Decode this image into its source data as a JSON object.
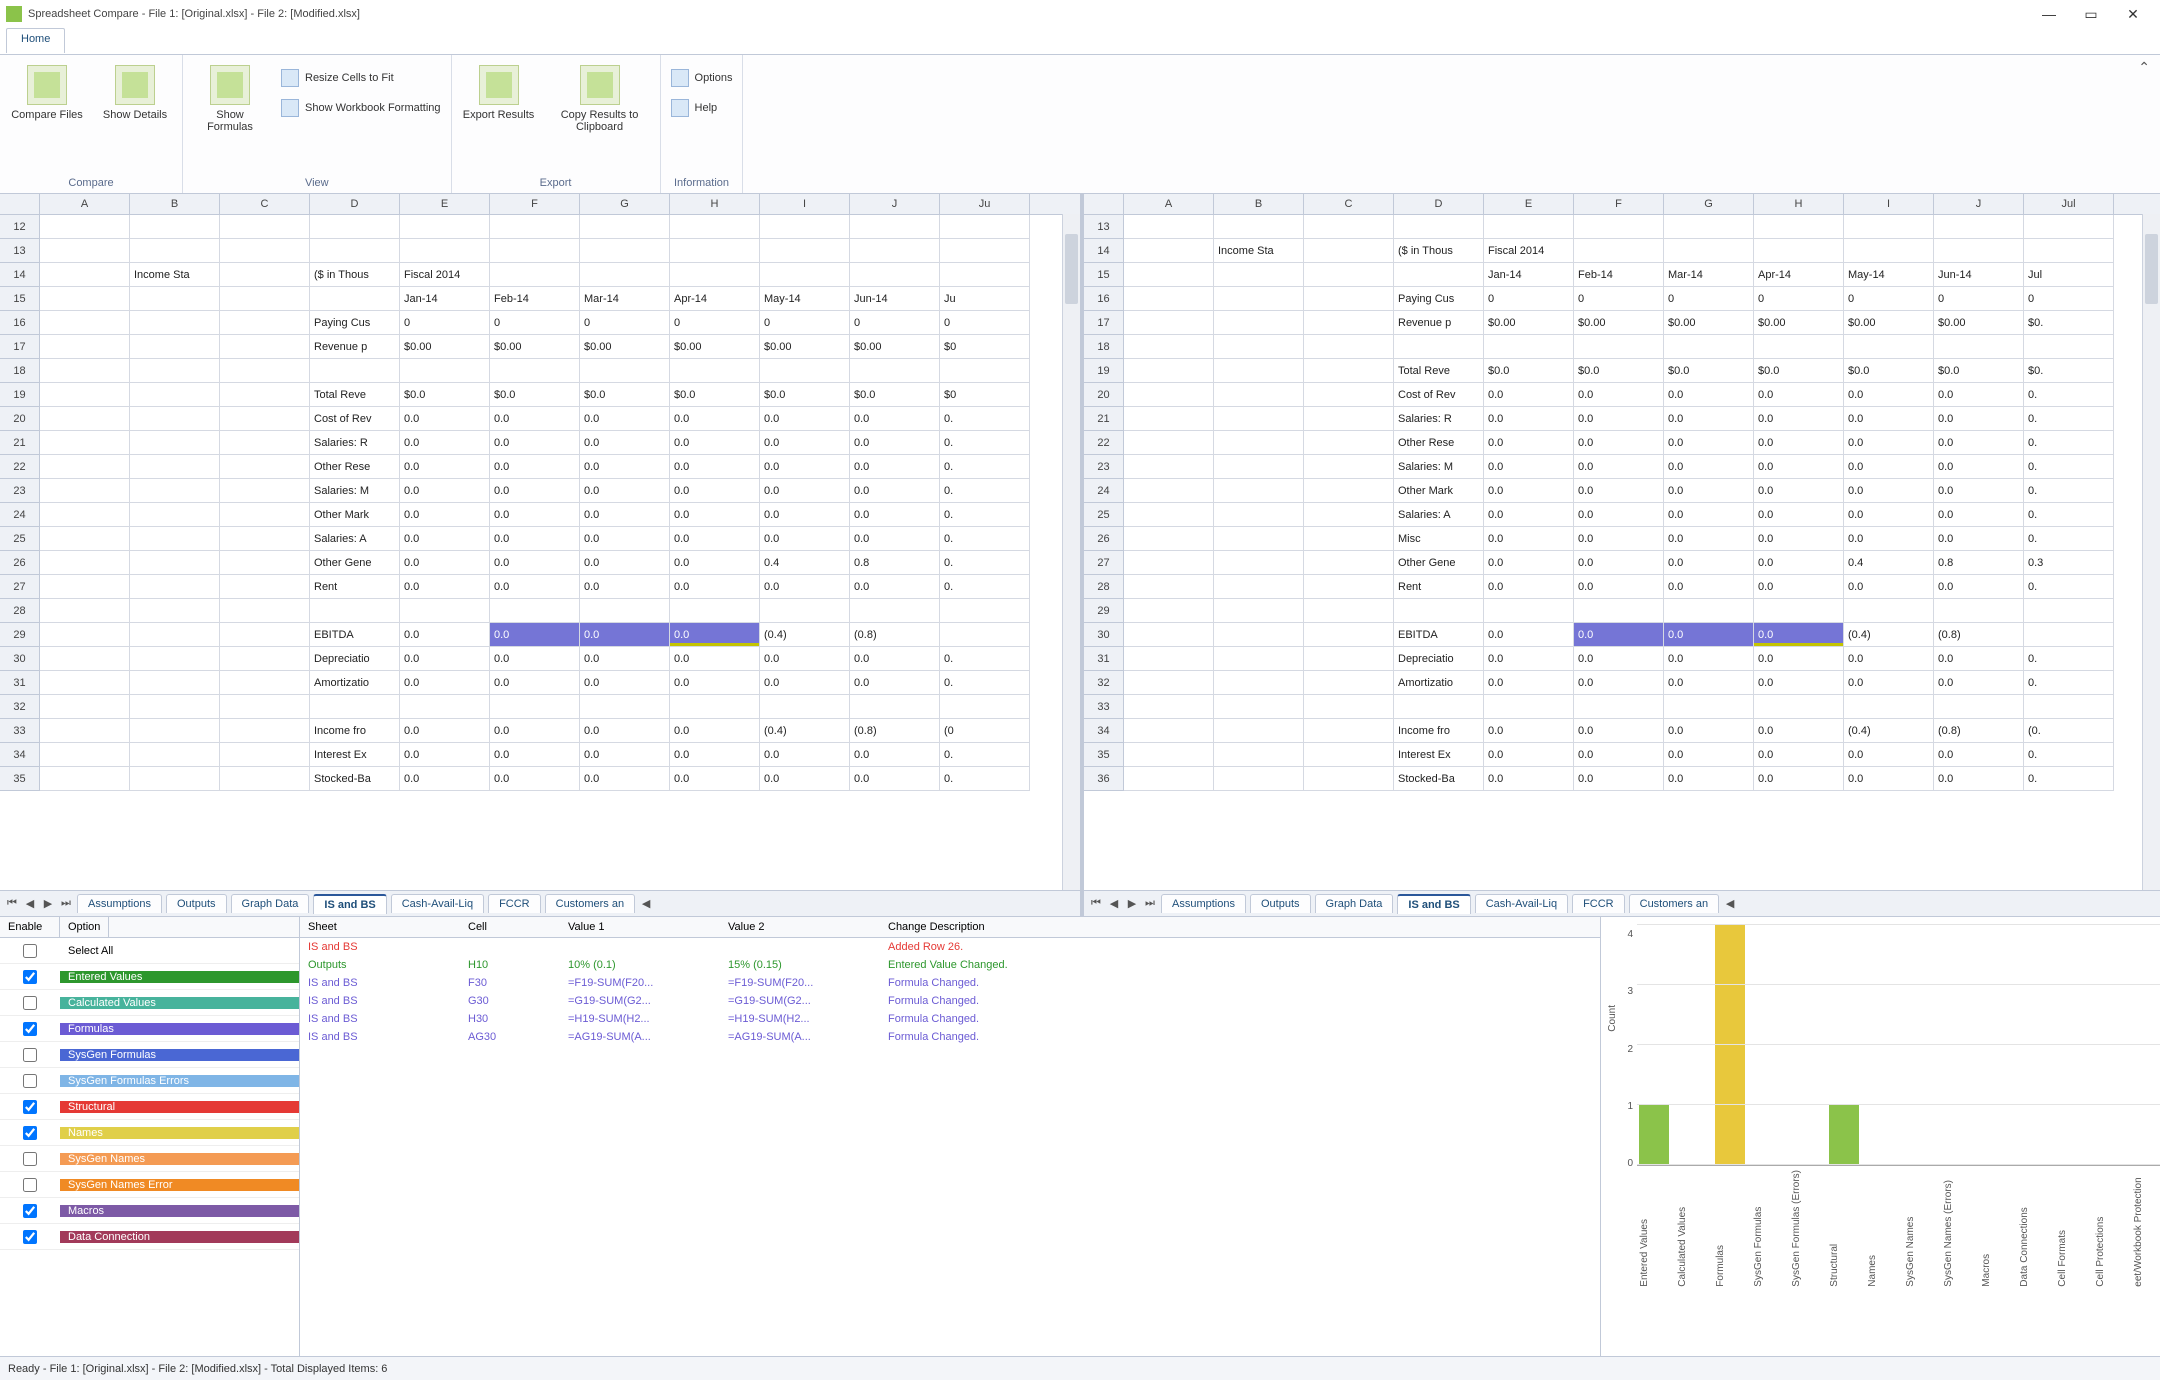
{
  "title": "Spreadsheet Compare - File 1: [Original.xlsx] - File 2: [Modified.xlsx]",
  "menubar": {
    "home": "Home"
  },
  "ribbon": {
    "groups": {
      "compare": {
        "label": "Compare",
        "buttons": {
          "compare_files": "Compare Files",
          "show_details": "Show Details"
        }
      },
      "view": {
        "label": "View",
        "buttons": {
          "show_formulas": "Show Formulas",
          "resize": "Resize Cells to Fit",
          "show_formatting": "Show Workbook Formatting"
        }
      },
      "export": {
        "label": "Export",
        "buttons": {
          "export_results": "Export Results",
          "copy_clipboard": "Copy Results to Clipboard"
        }
      },
      "information": {
        "label": "Information",
        "buttons": {
          "options": "Options",
          "help": "Help"
        }
      }
    }
  },
  "columns": [
    "A",
    "B",
    "C",
    "D",
    "E",
    "F",
    "G",
    "H",
    "I",
    "J",
    "Ju"
  ],
  "columns_right": [
    "A",
    "B",
    "C",
    "D",
    "E",
    "F",
    "G",
    "H",
    "I",
    "J",
    "Jul"
  ],
  "left_grid": {
    "start": 12,
    "rows": [
      {
        "r": 12
      },
      {
        "r": 13
      },
      {
        "r": 14,
        "B": "Income Sta",
        "D": "($ in Thous",
        "E": "Fiscal 2014"
      },
      {
        "r": 15,
        "E": "Jan-14",
        "F": "Feb-14",
        "G": "Mar-14",
        "H": "Apr-14",
        "I": "May-14",
        "J": "Jun-14",
        "K": "Ju"
      },
      {
        "r": 16,
        "D": "Paying Cus",
        "E": "0",
        "F": "0",
        "G": "0",
        "H": "0",
        "I": "0",
        "J": "0",
        "K": "0"
      },
      {
        "r": 17,
        "D": "Revenue p",
        "E": "$0.00",
        "F": "$0.00",
        "G": "$0.00",
        "H": "$0.00",
        "I": "$0.00",
        "J": "$0.00",
        "K": "$0"
      },
      {
        "r": 18
      },
      {
        "r": 19,
        "D": "Total Reve",
        "E": "$0.0",
        "F": "$0.0",
        "G": "$0.0",
        "H": "$0.0",
        "I": "$0.0",
        "J": "$0.0",
        "K": "$0"
      },
      {
        "r": 20,
        "D": "Cost of Rev",
        "E": "0.0",
        "F": "0.0",
        "G": "0.0",
        "H": "0.0",
        "I": "0.0",
        "J": "0.0",
        "K": "0."
      },
      {
        "r": 21,
        "D": "Salaries: R",
        "E": "0.0",
        "F": "0.0",
        "G": "0.0",
        "H": "0.0",
        "I": "0.0",
        "J": "0.0",
        "K": "0."
      },
      {
        "r": 22,
        "D": "Other Rese",
        "E": "0.0",
        "F": "0.0",
        "G": "0.0",
        "H": "0.0",
        "I": "0.0",
        "J": "0.0",
        "K": "0."
      },
      {
        "r": 23,
        "D": "Salaries: M",
        "E": "0.0",
        "F": "0.0",
        "G": "0.0",
        "H": "0.0",
        "I": "0.0",
        "J": "0.0",
        "K": "0."
      },
      {
        "r": 24,
        "D": "Other Mark",
        "E": "0.0",
        "F": "0.0",
        "G": "0.0",
        "H": "0.0",
        "I": "0.0",
        "J": "0.0",
        "K": "0."
      },
      {
        "r": 25,
        "D": "Salaries: A",
        "E": "0.0",
        "F": "0.0",
        "G": "0.0",
        "H": "0.0",
        "I": "0.0",
        "J": "0.0",
        "K": "0."
      },
      {
        "r": 26,
        "D": "Other Gene",
        "E": "0.0",
        "F": "0.0",
        "G": "0.0",
        "H": "0.0",
        "I": "0.4",
        "J": "0.8",
        "K": "0."
      },
      {
        "r": 27,
        "D": "Rent",
        "E": "0.0",
        "F": "0.0",
        "G": "0.0",
        "H": "0.0",
        "I": "0.0",
        "J": "0.0",
        "K": "0."
      },
      {
        "r": 28
      },
      {
        "r": 29,
        "D": "EBITDA",
        "E": "0.0",
        "F": "0.0",
        "G": "0.0",
        "H": "0.0",
        "I": "(0.4)",
        "J": "(0.8)",
        "hl": [
          "F",
          "G",
          "H"
        ]
      },
      {
        "r": 30,
        "D": "Depreciatio",
        "E": "0.0",
        "F": "0.0",
        "G": "0.0",
        "H": "0.0",
        "I": "0.0",
        "J": "0.0",
        "K": "0."
      },
      {
        "r": 31,
        "D": "Amortizatio",
        "E": "0.0",
        "F": "0.0",
        "G": "0.0",
        "H": "0.0",
        "I": "0.0",
        "J": "0.0",
        "K": "0."
      },
      {
        "r": 32
      },
      {
        "r": 33,
        "D": "Income fro",
        "E": "0.0",
        "F": "0.0",
        "G": "0.0",
        "H": "0.0",
        "I": "(0.4)",
        "J": "(0.8)",
        "K": "(0"
      },
      {
        "r": 34,
        "D": "Interest Ex",
        "E": "0.0",
        "F": "0.0",
        "G": "0.0",
        "H": "0.0",
        "I": "0.0",
        "J": "0.0",
        "K": "0."
      },
      {
        "r": 35,
        "D": "Stocked-Ba",
        "E": "0.0",
        "F": "0.0",
        "G": "0.0",
        "H": "0.0",
        "I": "0.0",
        "J": "0.0",
        "K": "0."
      }
    ]
  },
  "right_grid": {
    "start": 13,
    "rows": [
      {
        "r": 13
      },
      {
        "r": 14,
        "B": "Income Sta",
        "D": "($ in Thous",
        "E": "Fiscal 2014"
      },
      {
        "r": 15,
        "E": "Jan-14",
        "F": "Feb-14",
        "G": "Mar-14",
        "H": "Apr-14",
        "I": "May-14",
        "J": "Jun-14",
        "K": "Jul"
      },
      {
        "r": 16,
        "D": "Paying Cus",
        "E": "0",
        "F": "0",
        "G": "0",
        "H": "0",
        "I": "0",
        "J": "0",
        "K": "0"
      },
      {
        "r": 17,
        "D": "Revenue p",
        "E": "$0.00",
        "F": "$0.00",
        "G": "$0.00",
        "H": "$0.00",
        "I": "$0.00",
        "J": "$0.00",
        "K": "$0."
      },
      {
        "r": 18
      },
      {
        "r": 19,
        "D": "Total Reve",
        "E": "$0.0",
        "F": "$0.0",
        "G": "$0.0",
        "H": "$0.0",
        "I": "$0.0",
        "J": "$0.0",
        "K": "$0."
      },
      {
        "r": 20,
        "D": "Cost of Rev",
        "E": "0.0",
        "F": "0.0",
        "G": "0.0",
        "H": "0.0",
        "I": "0.0",
        "J": "0.0",
        "K": "0."
      },
      {
        "r": 21,
        "D": "Salaries: R",
        "E": "0.0",
        "F": "0.0",
        "G": "0.0",
        "H": "0.0",
        "I": "0.0",
        "J": "0.0",
        "K": "0."
      },
      {
        "r": 22,
        "D": "Other Rese",
        "E": "0.0",
        "F": "0.0",
        "G": "0.0",
        "H": "0.0",
        "I": "0.0",
        "J": "0.0",
        "K": "0."
      },
      {
        "r": 23,
        "D": "Salaries: M",
        "E": "0.0",
        "F": "0.0",
        "G": "0.0",
        "H": "0.0",
        "I": "0.0",
        "J": "0.0",
        "K": "0."
      },
      {
        "r": 24,
        "D": "Other Mark",
        "E": "0.0",
        "F": "0.0",
        "G": "0.0",
        "H": "0.0",
        "I": "0.0",
        "J": "0.0",
        "K": "0."
      },
      {
        "r": 25,
        "D": "Salaries: A",
        "E": "0.0",
        "F": "0.0",
        "G": "0.0",
        "H": "0.0",
        "I": "0.0",
        "J": "0.0",
        "K": "0."
      },
      {
        "r": 26,
        "D": "Misc",
        "E": "0.0",
        "F": "0.0",
        "G": "0.0",
        "H": "0.0",
        "I": "0.0",
        "J": "0.0",
        "K": "0."
      },
      {
        "r": 27,
        "D": "Other Gene",
        "E": "0.0",
        "F": "0.0",
        "G": "0.0",
        "H": "0.0",
        "I": "0.4",
        "J": "0.8",
        "K": "0.3"
      },
      {
        "r": 28,
        "D": "Rent",
        "E": "0.0",
        "F": "0.0",
        "G": "0.0",
        "H": "0.0",
        "I": "0.0",
        "J": "0.0",
        "K": "0."
      },
      {
        "r": 29
      },
      {
        "r": 30,
        "D": "EBITDA",
        "E": "0.0",
        "F": "0.0",
        "G": "0.0",
        "H": "0.0",
        "I": "(0.4)",
        "J": "(0.8)",
        "hl": [
          "F",
          "G",
          "H"
        ]
      },
      {
        "r": 31,
        "D": "Depreciatio",
        "E": "0.0",
        "F": "0.0",
        "G": "0.0",
        "H": "0.0",
        "I": "0.0",
        "J": "0.0",
        "K": "0."
      },
      {
        "r": 32,
        "D": "Amortizatio",
        "E": "0.0",
        "F": "0.0",
        "G": "0.0",
        "H": "0.0",
        "I": "0.0",
        "J": "0.0",
        "K": "0."
      },
      {
        "r": 33
      },
      {
        "r": 34,
        "D": "Income fro",
        "E": "0.0",
        "F": "0.0",
        "G": "0.0",
        "H": "0.0",
        "I": "(0.4)",
        "J": "(0.8)",
        "K": "(0."
      },
      {
        "r": 35,
        "D": "Interest Ex",
        "E": "0.0",
        "F": "0.0",
        "G": "0.0",
        "H": "0.0",
        "I": "0.0",
        "J": "0.0",
        "K": "0."
      },
      {
        "r": 36,
        "D": "Stocked-Ba",
        "E": "0.0",
        "F": "0.0",
        "G": "0.0",
        "H": "0.0",
        "I": "0.0",
        "J": "0.0",
        "K": "0."
      }
    ]
  },
  "sheet_tabs": [
    "Assumptions",
    "Outputs",
    "Graph Data",
    "IS and BS",
    "Cash-Avail-Liq",
    "FCCR",
    "Customers an"
  ],
  "sheet_active": "IS and BS",
  "options": {
    "header_enable": "Enable",
    "header_option": "Option",
    "select_all": "Select All",
    "items": [
      {
        "label": "Entered Values",
        "checked": true,
        "bg": "#2d972d"
      },
      {
        "label": "Calculated Values",
        "checked": false,
        "bg": "#47b39c"
      },
      {
        "label": "Formulas",
        "checked": true,
        "bg": "#6b5bd4"
      },
      {
        "label": "SysGen Formulas",
        "checked": false,
        "bg": "#4a67d4"
      },
      {
        "label": "SysGen Formulas Errors",
        "checked": false,
        "bg": "#7fb5e6"
      },
      {
        "label": "Structural",
        "checked": true,
        "bg": "#e53935"
      },
      {
        "label": "Names",
        "checked": true,
        "bg": "#e0cf49"
      },
      {
        "label": "SysGen Names",
        "checked": false,
        "bg": "#f49b54"
      },
      {
        "label": "SysGen Names Error",
        "checked": false,
        "bg": "#f08a24"
      },
      {
        "label": "Macros",
        "checked": true,
        "bg": "#7d5aa6"
      },
      {
        "label": "Data Connection",
        "checked": true,
        "bg": "#a23a5a"
      }
    ]
  },
  "diffs": {
    "headers": {
      "sheet": "Sheet",
      "cell": "Cell",
      "v1": "Value 1",
      "v2": "Value 2",
      "desc": "Change Description"
    },
    "rows": [
      {
        "sheet": "IS and BS",
        "cell": "",
        "v1": "",
        "v2": "",
        "desc": "Added Row 26.",
        "color": "#e53935"
      },
      {
        "sheet": "Outputs",
        "cell": "H10",
        "v1": "10% (0.1)",
        "v2": "15% (0.15)",
        "desc": "Entered Value Changed.",
        "color": "#2d972d"
      },
      {
        "sheet": "IS and BS",
        "cell": "F30",
        "v1": "=F19-SUM(F20...",
        "v2": "=F19-SUM(F20...",
        "desc": "Formula Changed.",
        "color": "#6b5bd4"
      },
      {
        "sheet": "IS and BS",
        "cell": "G30",
        "v1": "=G19-SUM(G2...",
        "v2": "=G19-SUM(G2...",
        "desc": "Formula Changed.",
        "color": "#6b5bd4"
      },
      {
        "sheet": "IS and BS",
        "cell": "H30",
        "v1": "=H19-SUM(H2...",
        "v2": "=H19-SUM(H2...",
        "desc": "Formula Changed.",
        "color": "#6b5bd4"
      },
      {
        "sheet": "IS and BS",
        "cell": "AG30",
        "v1": "=AG19-SUM(A...",
        "v2": "=AG19-SUM(A...",
        "desc": "Formula Changed.",
        "color": "#6b5bd4"
      }
    ]
  },
  "chart_data": {
    "type": "bar",
    "ylabel": "Count",
    "ylim": [
      0,
      4
    ],
    "ticks": [
      0,
      1,
      2,
      3,
      4
    ],
    "series": [
      {
        "name": "Entered Values",
        "value": 1,
        "color": "#8bc34a"
      },
      {
        "name": "Calculated Values",
        "value": 0,
        "color": "#8bc34a"
      },
      {
        "name": "Formulas",
        "value": 4,
        "color": "#e8c83c"
      },
      {
        "name": "SysGen Formulas",
        "value": 0,
        "color": "#8bc34a"
      },
      {
        "name": "SysGen Formulas (Errors)",
        "value": 0,
        "color": "#8bc34a"
      },
      {
        "name": "Structural",
        "value": 1,
        "color": "#8bc34a"
      },
      {
        "name": "Names",
        "value": 0,
        "color": "#8bc34a"
      },
      {
        "name": "SysGen Names",
        "value": 0,
        "color": "#8bc34a"
      },
      {
        "name": "SysGen Names (Errors)",
        "value": 0,
        "color": "#8bc34a"
      },
      {
        "name": "Macros",
        "value": 0,
        "color": "#8bc34a"
      },
      {
        "name": "Data Connections",
        "value": 0,
        "color": "#8bc34a"
      },
      {
        "name": "Cell Formats",
        "value": 0,
        "color": "#8bc34a"
      },
      {
        "name": "Cell Protections",
        "value": 0,
        "color": "#8bc34a"
      },
      {
        "name": "eet/Workbook Protection",
        "value": 0,
        "color": "#8bc34a"
      }
    ]
  },
  "statusbar": "Ready - File 1: [Original.xlsx] - File 2: [Modified.xlsx] - Total Displayed Items: 6"
}
